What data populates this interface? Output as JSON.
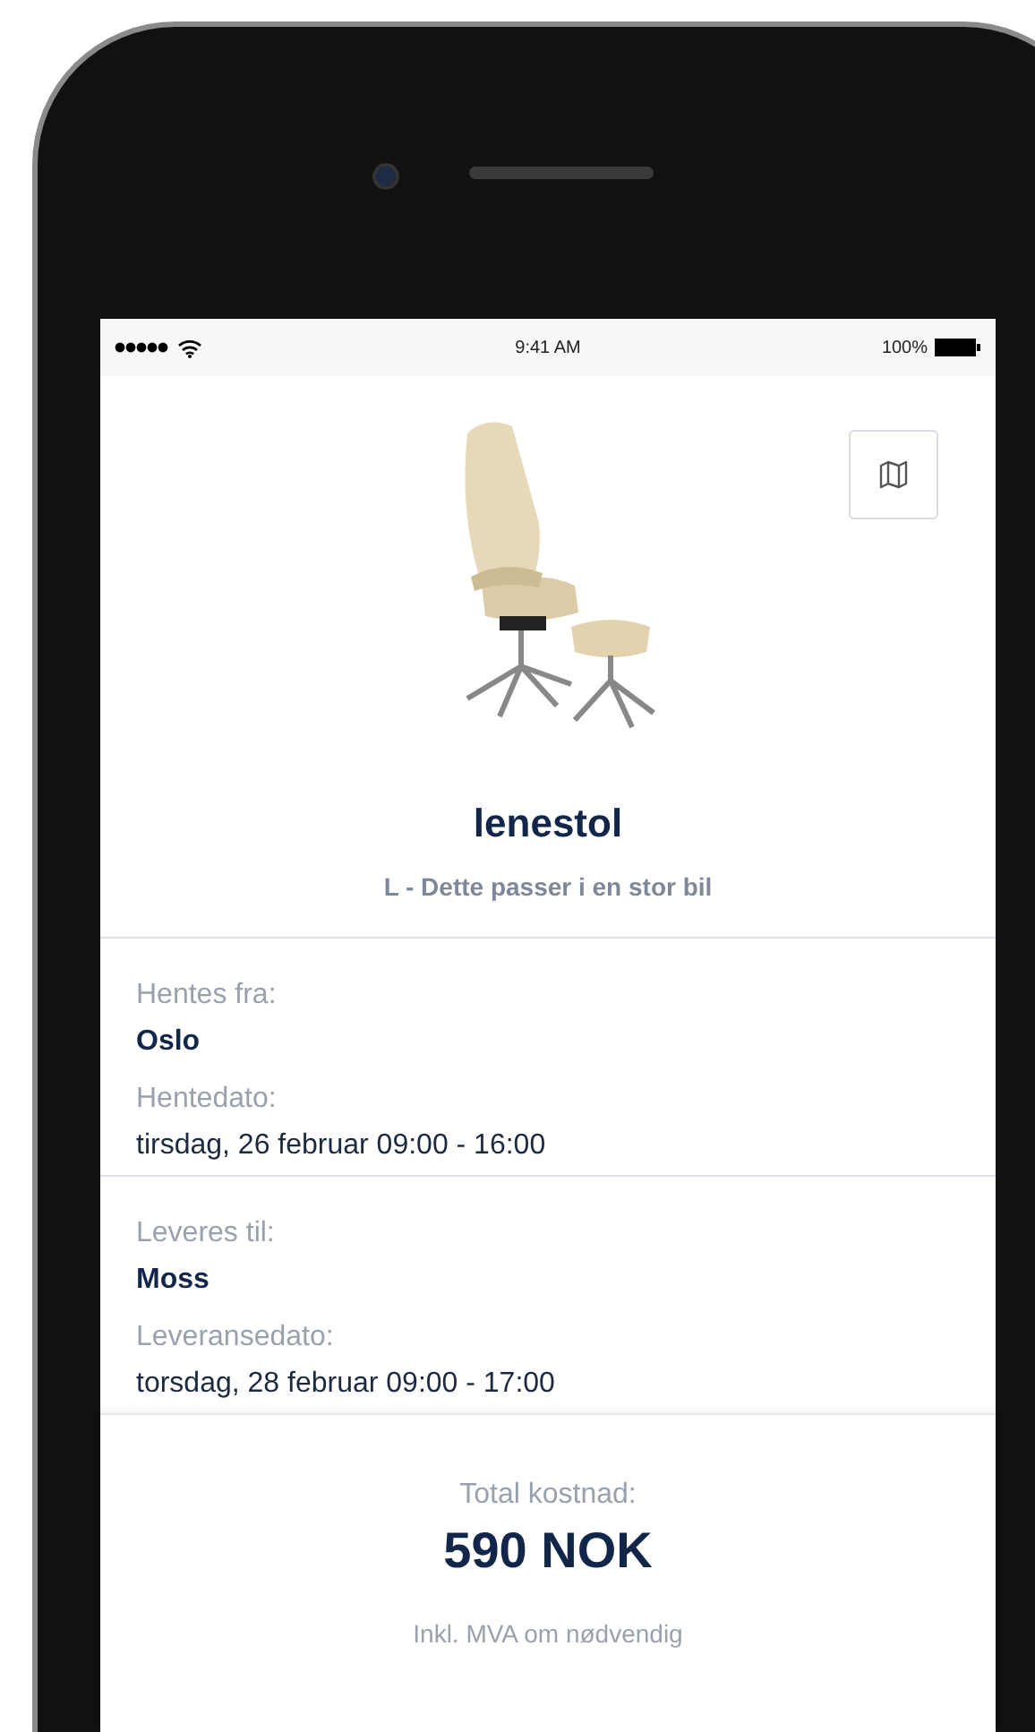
{
  "status_bar": {
    "time": "9:41 AM",
    "battery": "100%"
  },
  "product": {
    "name": "lenestol",
    "size": "L - Dette passer i en stor bil"
  },
  "sections": [
    {
      "fields": [
        {
          "kind": "place",
          "label": "Hentes fra:",
          "value": "Oslo"
        },
        {
          "kind": "date",
          "label": "Hentedato:",
          "value": "tirsdag, 26 februar 09:00 - 16:00"
        }
      ]
    },
    {
      "fields": [
        {
          "kind": "place",
          "label": "Leveres til:",
          "value": "Moss"
        },
        {
          "kind": "date",
          "label": "Leveransedato:",
          "value": "torsdag, 28 februar 09:00 - 17:00"
        }
      ]
    }
  ],
  "footer": {
    "label": "Total kostnad:",
    "price": "590 NOK",
    "note": "Inkl. MVA om nødvendig"
  }
}
